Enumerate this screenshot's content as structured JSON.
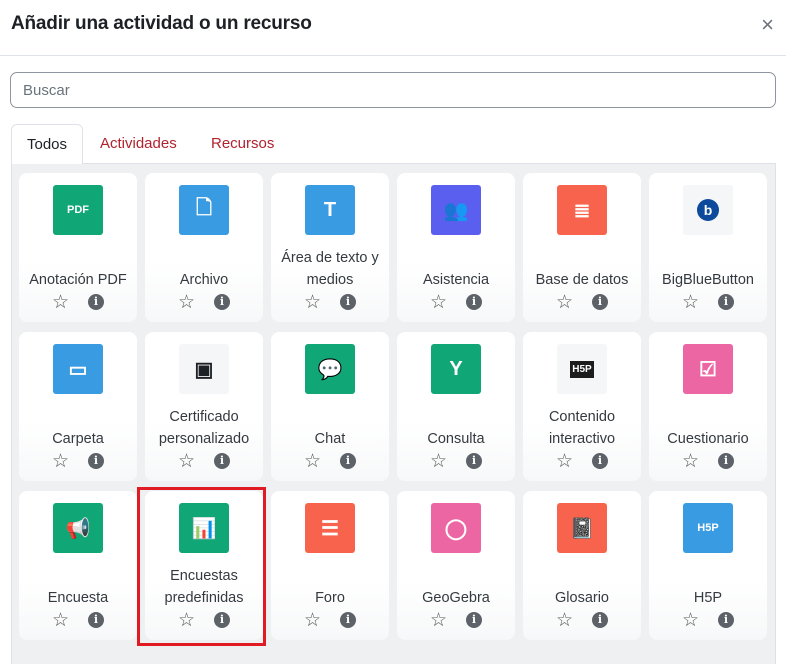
{
  "header": {
    "title": "Añadir una actividad o un recurso",
    "close": "×"
  },
  "search": {
    "placeholder": "Buscar"
  },
  "tabs": [
    {
      "label": "Todos"
    },
    {
      "label": "Actividades"
    },
    {
      "label": "Recursos"
    }
  ],
  "items": [
    {
      "label": "Anotación PDF",
      "icon": "pdf-annotation-icon",
      "color": "#11a676",
      "glyph": "PDF"
    },
    {
      "label": "Archivo",
      "icon": "file-icon",
      "color": "#399be2",
      "glyph": "🗋"
    },
    {
      "label": "Área de texto y medios",
      "icon": "text-area-icon",
      "color": "#399be2",
      "glyph": "T"
    },
    {
      "label": "Asistencia",
      "icon": "attendance-icon",
      "color": "#5b5ff0",
      "glyph": "👥"
    },
    {
      "label": "Base de datos",
      "icon": "database-icon",
      "color": "#f7634d",
      "glyph": "≣"
    },
    {
      "label": "BigBlueButton",
      "icon": "bigbluebutton-icon",
      "color": "#f5f6f8",
      "glyph": "b"
    },
    {
      "label": "Carpeta",
      "icon": "folder-icon",
      "color": "#399be2",
      "glyph": "▭"
    },
    {
      "label": "Certificado personalizado",
      "icon": "certificate-icon",
      "color": "#f5f6f8",
      "glyph": "▣"
    },
    {
      "label": "Chat",
      "icon": "chat-icon",
      "color": "#11a676",
      "glyph": "💬"
    },
    {
      "label": "Consulta",
      "icon": "choice-icon",
      "color": "#11a676",
      "glyph": "Y"
    },
    {
      "label": "Contenido interactivo",
      "icon": "h5p-content-icon",
      "color": "#f5f6f8",
      "glyph": "H5P"
    },
    {
      "label": "Cuestionario",
      "icon": "quiz-icon",
      "color": "#eb66a2",
      "glyph": "☑"
    },
    {
      "label": "Encuesta",
      "icon": "survey-icon",
      "color": "#11a676",
      "glyph": "📢"
    },
    {
      "label": "Encuestas predefinidas",
      "icon": "predefined-survey-icon",
      "color": "#11a676",
      "glyph": "📊"
    },
    {
      "label": "Foro",
      "icon": "forum-icon",
      "color": "#f7634d",
      "glyph": "☰"
    },
    {
      "label": "GeoGebra",
      "icon": "geogebra-icon",
      "color": "#eb66a2",
      "glyph": "◯"
    },
    {
      "label": "Glosario",
      "icon": "glossary-icon",
      "color": "#f7634d",
      "glyph": "📓"
    },
    {
      "label": "H5P",
      "icon": "h5p-icon",
      "color": "#399be2",
      "glyph": "H5P"
    }
  ]
}
